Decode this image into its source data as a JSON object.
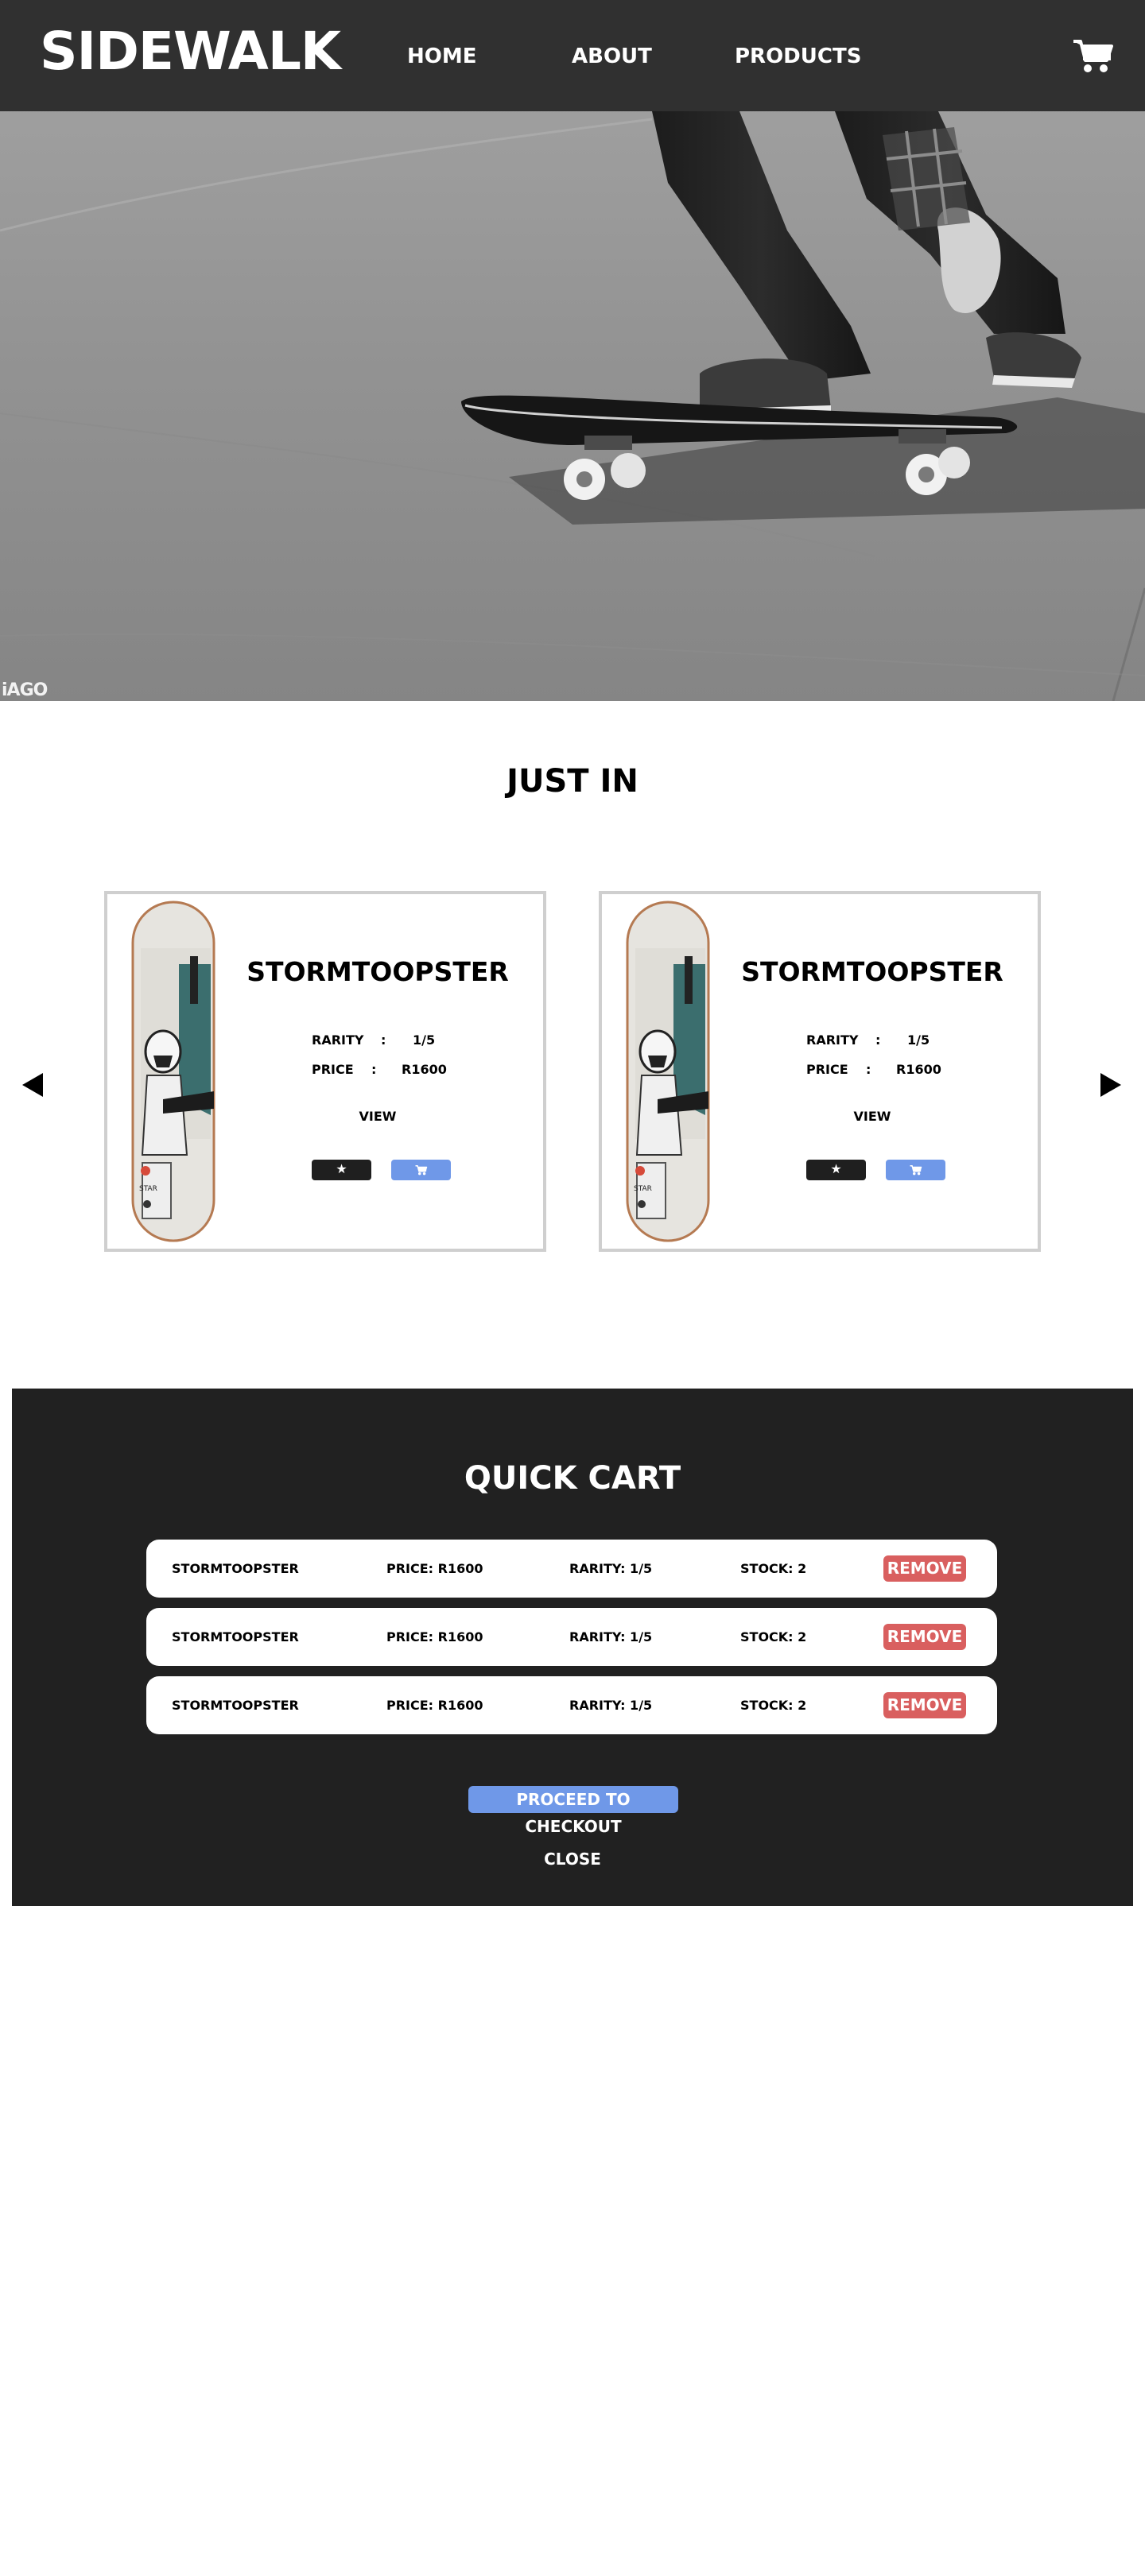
{
  "hero": {
    "watermark": "iAGO"
  },
  "nav": {
    "logo": "SIDEWALK",
    "links": [
      "HOME",
      "ABOUT",
      "PRODUCTS"
    ],
    "cart_icon": "shopping-cart-icon"
  },
  "just_in": {
    "title": "JUST IN",
    "prev_icon": "arrow-left-icon",
    "next_icon": "arrow-right-icon",
    "products": [
      {
        "name": "STORMTOOPSTER",
        "rarity_label": "RARITY",
        "rarity_value": "1/5",
        "price_label": "PRICE",
        "price_value": "R1600",
        "separator": ":",
        "view_label": "VIEW",
        "favorite_glyph": "★"
      },
      {
        "name": "STORMTOOPSTER",
        "rarity_label": "RARITY",
        "rarity_value": "1/5",
        "price_label": "PRICE",
        "price_value": "R1600",
        "separator": ":",
        "view_label": "VIEW",
        "favorite_glyph": "★"
      }
    ]
  },
  "quick_cart": {
    "title": "QUICK CART",
    "items": [
      {
        "name": "STORMTOOPSTER",
        "price": "PRICE: R1600",
        "rarity": "RARITY: 1/5",
        "stock": "STOCK: 2",
        "remove_label": "REMOVE"
      },
      {
        "name": "STORMTOOPSTER",
        "price": "PRICE: R1600",
        "rarity": "RARITY: 1/5",
        "stock": "STOCK: 2",
        "remove_label": "REMOVE"
      },
      {
        "name": "STORMTOOPSTER",
        "price": "PRICE: R1600",
        "rarity": "RARITY: 1/5",
        "stock": "STOCK: 2",
        "remove_label": "REMOVE"
      }
    ],
    "checkout_label": "PROCEED TO CHECKOUT",
    "close_label": "CLOSE"
  },
  "colors": {
    "nav_bg": "#242424",
    "cart_panel_bg": "#212121",
    "accent_blue": "#6f98e8",
    "remove_red": "#d95f5f",
    "card_border": "#cfcfcf"
  }
}
